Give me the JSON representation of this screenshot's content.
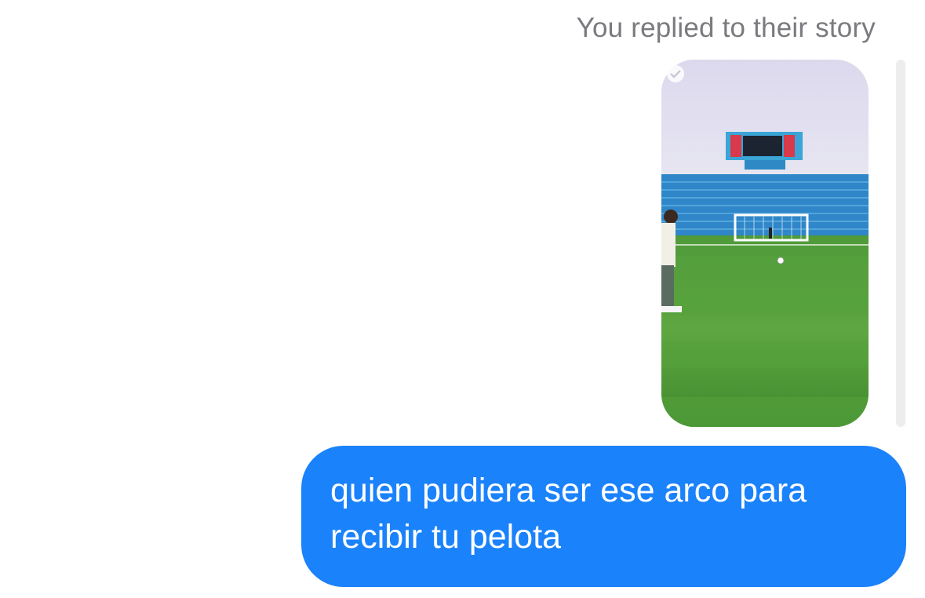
{
  "story_reply": {
    "caption": "You replied to their story",
    "thumbnail_icon": "story-image-thumbnail"
  },
  "message": {
    "lines": [
      "quien pudiera ser ese arco para",
      "recibir tu pelota"
    ]
  },
  "colors": {
    "bubble": "#1a82fb",
    "caption_text": "#7a7a7f",
    "rail": "#ededed"
  }
}
